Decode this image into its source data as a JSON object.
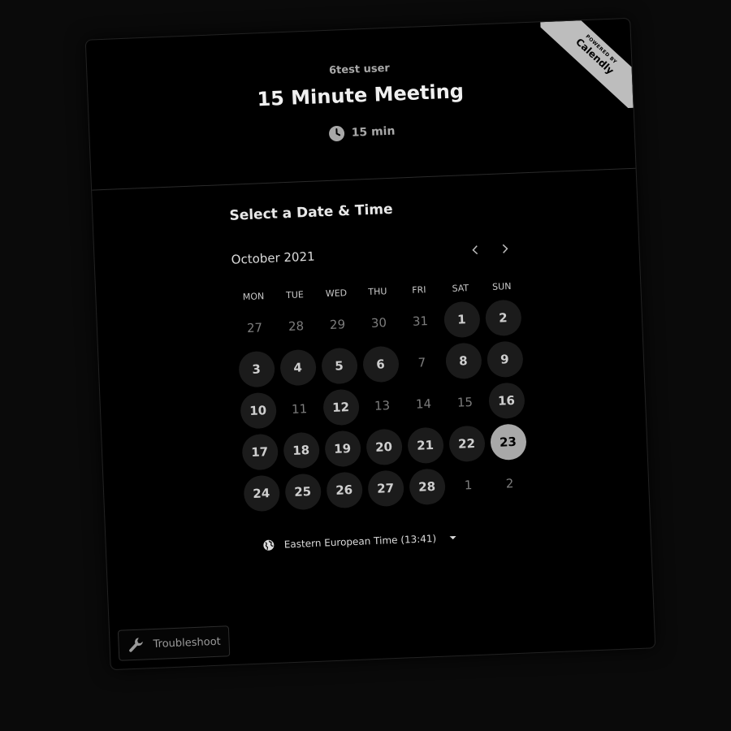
{
  "branding": {
    "powered_by": "POWERED BY",
    "brand": "Calendly"
  },
  "event": {
    "host": "6test user",
    "title": "15 Minute Meeting",
    "duration": "15 min",
    "duration_icon": "clock-icon"
  },
  "picker": {
    "section_title": "Select a Date & Time",
    "month_label": "October 2021",
    "prev_icon": "chevron-left-icon",
    "next_icon": "chevron-right-icon",
    "weekdays": [
      "MON",
      "TUE",
      "WED",
      "THU",
      "FRI",
      "SAT",
      "SUN"
    ],
    "days": [
      {
        "label": "27",
        "state": "muted"
      },
      {
        "label": "28",
        "state": "muted"
      },
      {
        "label": "29",
        "state": "muted"
      },
      {
        "label": "30",
        "state": "muted"
      },
      {
        "label": "31",
        "state": "muted"
      },
      {
        "label": "1",
        "state": "available"
      },
      {
        "label": "2",
        "state": "available"
      },
      {
        "label": "3",
        "state": "available"
      },
      {
        "label": "4",
        "state": "available"
      },
      {
        "label": "5",
        "state": "available"
      },
      {
        "label": "6",
        "state": "available"
      },
      {
        "label": "7",
        "state": "muted"
      },
      {
        "label": "8",
        "state": "available"
      },
      {
        "label": "9",
        "state": "available"
      },
      {
        "label": "10",
        "state": "available"
      },
      {
        "label": "11",
        "state": "muted"
      },
      {
        "label": "12",
        "state": "available"
      },
      {
        "label": "13",
        "state": "muted"
      },
      {
        "label": "14",
        "state": "muted"
      },
      {
        "label": "15",
        "state": "muted"
      },
      {
        "label": "16",
        "state": "available"
      },
      {
        "label": "17",
        "state": "available"
      },
      {
        "label": "18",
        "state": "available"
      },
      {
        "label": "19",
        "state": "available"
      },
      {
        "label": "20",
        "state": "available"
      },
      {
        "label": "21",
        "state": "available"
      },
      {
        "label": "22",
        "state": "available"
      },
      {
        "label": "23",
        "state": "selected"
      },
      {
        "label": "24",
        "state": "available"
      },
      {
        "label": "25",
        "state": "available"
      },
      {
        "label": "26",
        "state": "available"
      },
      {
        "label": "27",
        "state": "available"
      },
      {
        "label": "28",
        "state": "available"
      },
      {
        "label": "1",
        "state": "muted"
      },
      {
        "label": "2",
        "state": "muted"
      }
    ]
  },
  "timezone": {
    "label": "Eastern European Time (13:41)",
    "icon": "globe-icon"
  },
  "troubleshoot": {
    "label": "Troubleshoot",
    "icon": "wrench-icon"
  },
  "colors": {
    "background": "#000000",
    "available_day": "#1b1b1b",
    "selected_day": "#a8a8a8",
    "ribbon": "#bdbdbd"
  }
}
